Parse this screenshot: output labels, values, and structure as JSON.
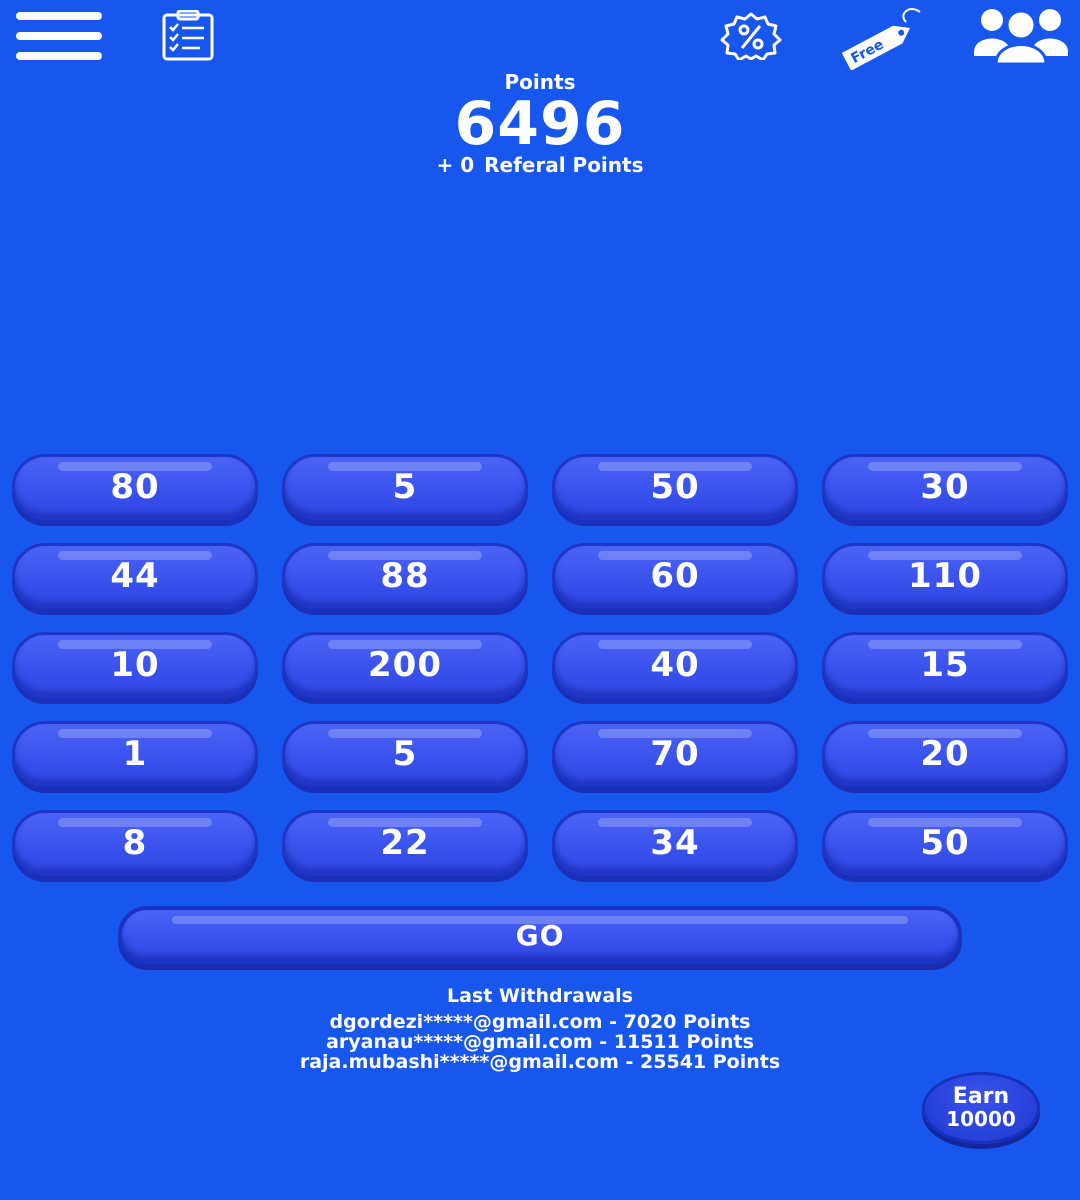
{
  "header": {
    "icons": [
      "hamburger-menu-icon",
      "task-checklist-icon",
      "discount-badge-icon",
      "free-tag-icon",
      "users-group-icon"
    ],
    "free_tag_text": "Free"
  },
  "points": {
    "label": "Points",
    "value": "6496",
    "referral_prefix": "+ 0",
    "referral_label": "Referal Points"
  },
  "grid": {
    "values": [
      "80",
      "5",
      "50",
      "30",
      "44",
      "88",
      "60",
      "110",
      "10",
      "200",
      "40",
      "15",
      "1",
      "5",
      "70",
      "20",
      "8",
      "22",
      "34",
      "50"
    ]
  },
  "go_label": "GO",
  "withdrawals": {
    "title": "Last Withdrawals",
    "items": [
      "dgordezi*****@gmail.com - 7020 Points",
      "aryanau*****@gmail.com - 11511 Points",
      "raja.mubashi*****@gmail.com - 25541 Points"
    ]
  },
  "earn": {
    "line1": "Earn",
    "line2": "10000"
  },
  "colors": {
    "background": "#1757EE",
    "button": "#3B53EE",
    "button_border": "#1E36C7",
    "text": "#FFFFFF"
  }
}
